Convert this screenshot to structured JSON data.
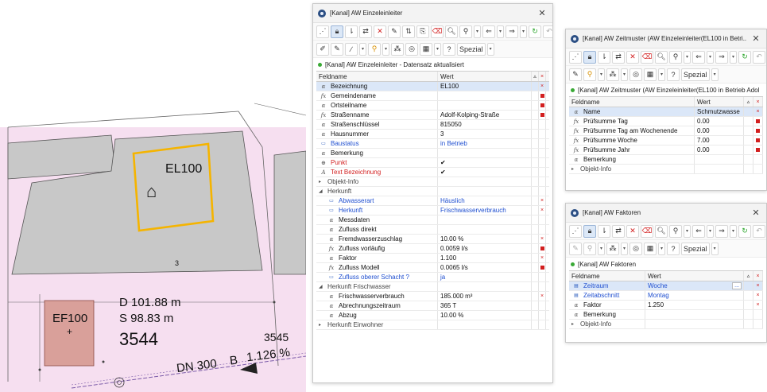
{
  "colors": {
    "parcel_fill": "#f6dff0",
    "building_fill": "#c8c8c8",
    "highlight_orange": "#f5b400",
    "inlet_fill": "#d9a09a",
    "select_row": "#dbe7f8",
    "link_blue": "#1f4fd0",
    "required_red": "#d21f1f",
    "status_green": "#39a935"
  },
  "map": {
    "building_label": "EL100",
    "parcel_number_small": "3",
    "depth_d": "D 101.88 m",
    "depth_s": "S 98.83 m",
    "parcel_big": "3544",
    "ef_label": "EF100",
    "parcel_right": "3545",
    "pipe_label": "DN 300",
    "pipe_b": "B",
    "pipe_slope": "1.126 %",
    "house_icon": "house-symbol-icon"
  },
  "win1": {
    "title": "[Kanal] AW Einzeleinleiter",
    "status": "[Kanal] AW Einzeleinleiter  - Datensatz aktualisiert",
    "spezial_label": "Spezial",
    "col_feldname": "Feldname",
    "col_wert": "Wert",
    "rows": [
      {
        "icon": "α",
        "name": "Bezeichnung",
        "value": "EL100",
        "mark": "×"
      },
      {
        "icon": "fx",
        "name": "Gemeindename",
        "value": "",
        "mark": "■"
      },
      {
        "icon": "α",
        "name": "Ortsteilname",
        "value": "",
        "mark": "■"
      },
      {
        "icon": "fx",
        "name": "Straßenname",
        "value": "Adolf-Kolping-Straße",
        "mark": "■"
      },
      {
        "icon": "α",
        "name": "Straßenschlüssel",
        "value": "815050",
        "mark": ""
      },
      {
        "icon": "α",
        "name": "Hausnummer",
        "value": "3",
        "mark": ""
      },
      {
        "icon": "▭",
        "name": "Baustatus",
        "value": "in Betrieb",
        "mark": ""
      },
      {
        "icon": "α",
        "name": "Bemerkung",
        "value": "",
        "mark": ""
      },
      {
        "icon": "⊕",
        "name": "Punkt",
        "value": "✔",
        "mark": ""
      },
      {
        "icon": "A",
        "name": "Text Bezeichnung",
        "value": "✔",
        "mark": ""
      }
    ],
    "section_objekt_info": "Objekt-Info",
    "section_herkunft": "Herkunft",
    "herkunft_rows": [
      {
        "icon": "▭",
        "name": "Abwasserart",
        "value": "Häuslich",
        "mark": "×"
      },
      {
        "icon": "▭",
        "name": "Herkunft",
        "value": "Frischwasserverbrauch",
        "mark": "×"
      },
      {
        "icon": "α",
        "name": "Messdaten",
        "value": "",
        "mark": ""
      },
      {
        "icon": "α",
        "name": "Zufluss direkt",
        "value": "",
        "mark": ""
      },
      {
        "icon": "α",
        "name": "Fremdwasserzuschlag",
        "value": "10.00 %",
        "mark": "×"
      },
      {
        "icon": "fx",
        "name": "Zufluss vorläufig",
        "value": "0.0059 l/s",
        "mark": "■"
      },
      {
        "icon": "α",
        "name": "Faktor",
        "value": "1.100",
        "mark": "×"
      },
      {
        "icon": "fx",
        "name": "Zufluss Modell",
        "value": "0.0065 l/s",
        "mark": "■"
      },
      {
        "icon": "▭",
        "name": "Zufluss oberer Schacht ?",
        "value": "ja",
        "mark": ""
      }
    ],
    "section_herkunft_frisch": "Herkunft Frischwasser",
    "frisch_rows": [
      {
        "icon": "α",
        "name": "Frischwasserverbrauch",
        "value": "185.000 m³",
        "mark": "×"
      },
      {
        "icon": "α",
        "name": "Abrechnungszeitraum",
        "value": "365 T",
        "mark": ""
      },
      {
        "icon": "α",
        "name": "Abzug",
        "value": "10.00 %",
        "mark": ""
      }
    ],
    "section_herkunft_einwohner": "Herkunft Einwohner"
  },
  "win2": {
    "title": "[Kanal] AW Zeitmuster (AW Einzeleinleiter(EL100 in Betri...",
    "status": "[Kanal] AW Zeitmuster (AW Einzeleinleiter(EL100 in Betrieb Adol",
    "spezial_label": "Spezial",
    "col_feldname": "Feldname",
    "col_wert": "Wert",
    "rows": [
      {
        "icon": "α",
        "name": "Name",
        "value": "Schmutzwasse",
        "mark": "×"
      },
      {
        "icon": "fx",
        "name": "Prüfsumme Tag",
        "value": "0.00",
        "mark": "■"
      },
      {
        "icon": "fx",
        "name": "Prüfsumme Tag am Wochenende",
        "value": "0.00",
        "mark": "■"
      },
      {
        "icon": "fx",
        "name": "Prüfsumme Woche",
        "value": "7.00",
        "mark": "■"
      },
      {
        "icon": "fx",
        "name": "Prüfsumme Jahr",
        "value": "0.00",
        "mark": "■"
      },
      {
        "icon": "α",
        "name": "Bemerkung",
        "value": "",
        "mark": ""
      }
    ],
    "section_objekt_info": "Objekt-Info"
  },
  "win3": {
    "title": "[Kanal] AW Faktoren",
    "status": "[Kanal] AW Faktoren",
    "spezial_label": "Spezial",
    "col_feldname": "Feldname",
    "col_wert": "Wert",
    "rows": [
      {
        "icon": "▤",
        "name": "Zeitraum",
        "value": "Woche",
        "mark": "×"
      },
      {
        "icon": "▤",
        "name": "Zeitabschnitt",
        "value": "Montag",
        "mark": "×"
      },
      {
        "icon": "α",
        "name": "Faktor",
        "value": "1.250",
        "mark": "×"
      },
      {
        "icon": "α",
        "name": "Bemerkung",
        "value": "",
        "mark": ""
      }
    ],
    "section_objekt_info": "Objekt-Info",
    "zeitraum_button": "..."
  }
}
